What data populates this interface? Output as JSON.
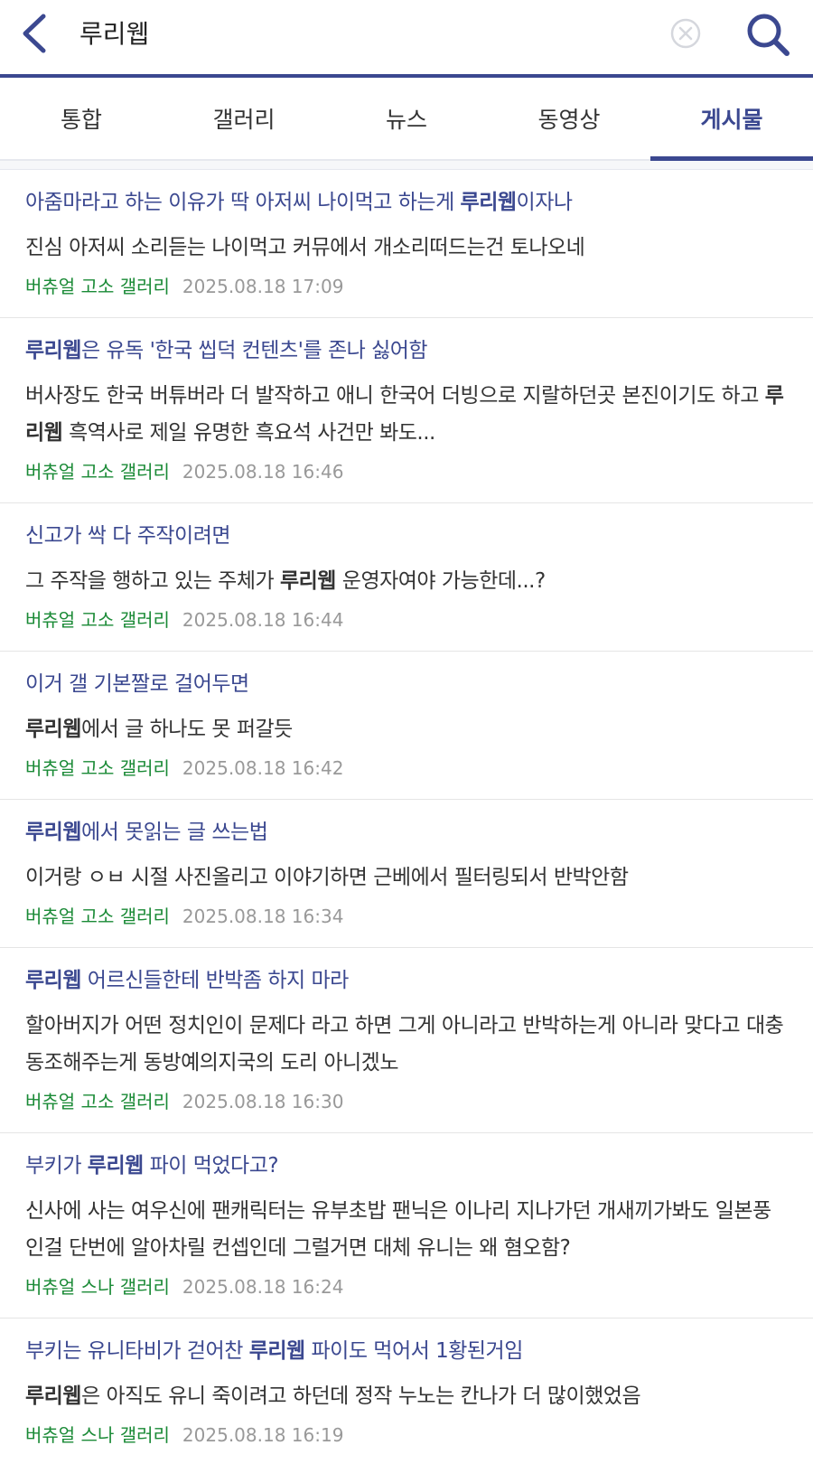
{
  "header": {
    "query": "루리웹"
  },
  "tabs": [
    {
      "label": "통합",
      "active": false
    },
    {
      "label": "갤러리",
      "active": false
    },
    {
      "label": "뉴스",
      "active": false
    },
    {
      "label": "동영상",
      "active": false
    },
    {
      "label": "게시물",
      "active": true
    }
  ],
  "colors": {
    "accent": "#3b4890",
    "gallery": "#1a8a36",
    "date": "#999999"
  },
  "icons": {
    "back": "chevron-left-icon",
    "clear": "circle-x-icon",
    "search": "search-icon"
  },
  "posts": [
    {
      "title": [
        {
          "t": "아줌마라고 하는 이유가 딱 아저씨 나이먹고 하는게 "
        },
        {
          "t": "루리웹",
          "b": true
        },
        {
          "t": "이자나"
        }
      ],
      "body": [
        {
          "t": "진심 아저씨 소리듣는 나이먹고 커뮤에서 개소리떠드는건 토나오네"
        }
      ],
      "gallery": "버츄얼 고소 갤러리",
      "date": "2025.08.18 17:09"
    },
    {
      "title": [
        {
          "t": "루리웹",
          "b": true
        },
        {
          "t": "은 유독 '한국 씹덕 컨텐츠'를 존나 싫어함"
        }
      ],
      "body": [
        {
          "t": "버사장도 한국 버튜버라 더 발작하고 애니 한국어 더빙으로 지랄하던곳 본진이기도 하고 "
        },
        {
          "t": "루리웹",
          "b": true
        },
        {
          "t": " 흑역사로 제일 유명한 흑요석 사건만 봐도..."
        }
      ],
      "gallery": "버츄얼 고소 갤러리",
      "date": "2025.08.18 16:46"
    },
    {
      "title": [
        {
          "t": "신고가 싹 다 주작이려면"
        }
      ],
      "body": [
        {
          "t": "그 주작을 행하고 있는 주체가 "
        },
        {
          "t": "루리웹",
          "b": true
        },
        {
          "t": " 운영자여야 가능한데...?"
        }
      ],
      "gallery": "버츄얼 고소 갤러리",
      "date": "2025.08.18 16:44"
    },
    {
      "title": [
        {
          "t": "이거 갤 기본짤로 걸어두면"
        }
      ],
      "body": [
        {
          "t": "루리웹",
          "b": true
        },
        {
          "t": "에서 글 하나도 못 퍼갈듯"
        }
      ],
      "gallery": "버츄얼 고소 갤러리",
      "date": "2025.08.18 16:42"
    },
    {
      "title": [
        {
          "t": "루리웹",
          "b": true
        },
        {
          "t": "에서 못읽는 글 쓰는법"
        }
      ],
      "body": [
        {
          "t": "이거랑 ㅇㅂ 시절 사진올리고 이야기하면 근베에서 필터링되서 반박안함"
        }
      ],
      "gallery": "버츄얼 고소 갤러리",
      "date": "2025.08.18 16:34"
    },
    {
      "title": [
        {
          "t": "루리웹",
          "b": true
        },
        {
          "t": " 어르신들한테 반박좀 하지 마라"
        }
      ],
      "body": [
        {
          "t": "할아버지가 어떤 정치인이 문제다 라고 하면 그게 아니라고 반박하는게 아니라 맞다고 대충 동조해주는게 동방예의지국의 도리 아니겠노"
        }
      ],
      "gallery": "버츄얼 고소 갤러리",
      "date": "2025.08.18 16:30"
    },
    {
      "title": [
        {
          "t": "부키가 "
        },
        {
          "t": "루리웹",
          "b": true
        },
        {
          "t": " 파이 먹었다고?"
        }
      ],
      "body": [
        {
          "t": "신사에 사는 여우신에 팬캐릭터는 유부초밥 팬닉은 이나리 지나가던 개새끼가봐도 일본풍인걸 단번에 알아차릴 컨셉인데 그럴거면 대체 유니는 왜 혐오함?"
        }
      ],
      "gallery": "버츄얼 스나 갤러리",
      "date": "2025.08.18 16:24"
    },
    {
      "title": [
        {
          "t": "부키는 유니타비가 걷어찬 "
        },
        {
          "t": "루리웹",
          "b": true
        },
        {
          "t": " 파이도 먹어서 1황된거임"
        }
      ],
      "body": [
        {
          "t": "루리웹",
          "b": true
        },
        {
          "t": "은 아직도 유니 죽이려고 하던데 정작 누노는 칸나가 더 많이했었음"
        }
      ],
      "gallery": "버츄얼 스나 갤러리",
      "date": "2025.08.18 16:19"
    }
  ]
}
